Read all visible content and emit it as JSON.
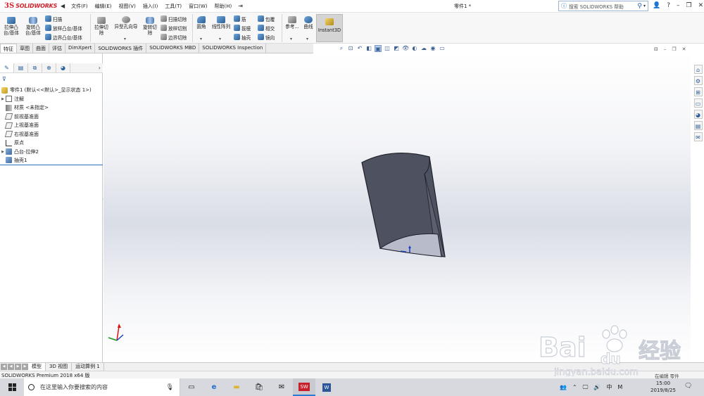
{
  "titlebar": {
    "logo_ds": "3S",
    "logo_text": "SOLIDWORKS",
    "menu": [
      "文件(F)",
      "编辑(E)",
      "视图(V)",
      "插入(I)",
      "工具(T)",
      "窗口(W)",
      "帮助(H)"
    ],
    "document_title": "零件1 *",
    "search_placeholder": "搜索 SOLIDWORKS 帮助"
  },
  "command_manager": {
    "extrude_boss": "拉伸凸\n台/基体",
    "revolve_boss": "旋转凸\n台/基体",
    "sweep": "扫描",
    "loft_boss": "放样凸台/基体",
    "boundary_boss": "边界凸台/基体",
    "extrude_cut": "拉伸切\n除",
    "hole_wizard": "异型孔向导",
    "revolve_cut": "旋转切\n除",
    "swept_cut": "扫描切除",
    "lofted_cut": "放样切割",
    "boundary_cut": "边界切除",
    "fillet": "圆角",
    "linear_pattern": "线性阵列",
    "rib": "筋",
    "draft": "拔模",
    "shell": "抽壳",
    "wrap": "包覆",
    "intersect": "相交",
    "mirror": "镜向",
    "reference": "参考...",
    "curves": "曲线",
    "instant3d": "Instant3D"
  },
  "tabs": [
    "特征",
    "草图",
    "曲面",
    "评估",
    "DimXpert",
    "SOLIDWORKS 插件",
    "SOLIDWORKS MBD",
    "SOLIDWORKS Inspection"
  ],
  "feature_tree": [
    {
      "label": "零件1 (默认<<默认>_显示状态 1>)",
      "icon": "part-icon"
    },
    {
      "label": "注解",
      "icon": "annotations-icon"
    },
    {
      "label": "材质 <未指定>",
      "icon": "material-icon"
    },
    {
      "label": "前视基准面",
      "icon": "plane-icon"
    },
    {
      "label": "上视基准面",
      "icon": "plane-icon"
    },
    {
      "label": "右视基准面",
      "icon": "plane-icon"
    },
    {
      "label": "原点",
      "icon": "origin-icon"
    },
    {
      "label": "凸台-拉伸2",
      "icon": "extrude-icon"
    },
    {
      "label": "抽壳1",
      "icon": "shell-icon"
    }
  ],
  "bottom_tabs": [
    "模型",
    "3D 视图",
    "运动算例 1"
  ],
  "status": {
    "text": "SOLIDWORKS Premium 2018 x64 版",
    "units": "在编辑 零件"
  },
  "taskbar": {
    "search_placeholder": "在这里输入你要搜索的内容",
    "ime": "中",
    "time": "15:00",
    "date": "2019/8/25",
    "notifications": "2"
  },
  "watermark": {
    "brand": "Bai",
    "brand2": "du",
    "cn": "经验",
    "url": "jingyan.baidu.com"
  },
  "colors": {
    "accent": "#2c6fc7",
    "logo_red": "#d0202a",
    "model_dark": "#4d5160",
    "model_inner": "#b7bbca"
  }
}
